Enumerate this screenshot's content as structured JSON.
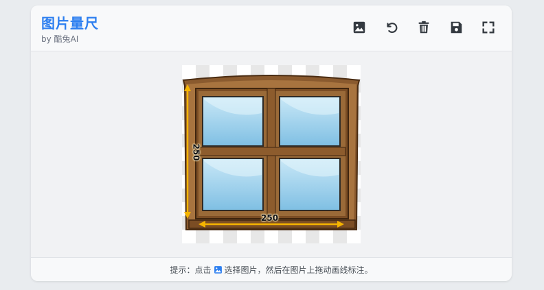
{
  "app": {
    "title": "图片量尺",
    "subtitle": "by 酷兔AI"
  },
  "toolbar": [
    {
      "icon": "image-icon",
      "action": "select-image"
    },
    {
      "icon": "undo-icon",
      "action": "undo"
    },
    {
      "icon": "trash-icon",
      "action": "delete"
    },
    {
      "icon": "save-icon",
      "action": "save"
    },
    {
      "icon": "fullscreen-icon",
      "action": "fullscreen"
    }
  ],
  "measurements": {
    "horizontal": "250",
    "vertical": "250"
  },
  "footer": {
    "hint_prefix": "提示：点击",
    "hint_suffix": "选择图片，然后在图片上拖动画线标注。"
  },
  "colors": {
    "title": "#2d7ff0",
    "measure_line": "#f5b400",
    "frame_wood": "#9b6a3a",
    "glass": "#8ec9ea"
  }
}
